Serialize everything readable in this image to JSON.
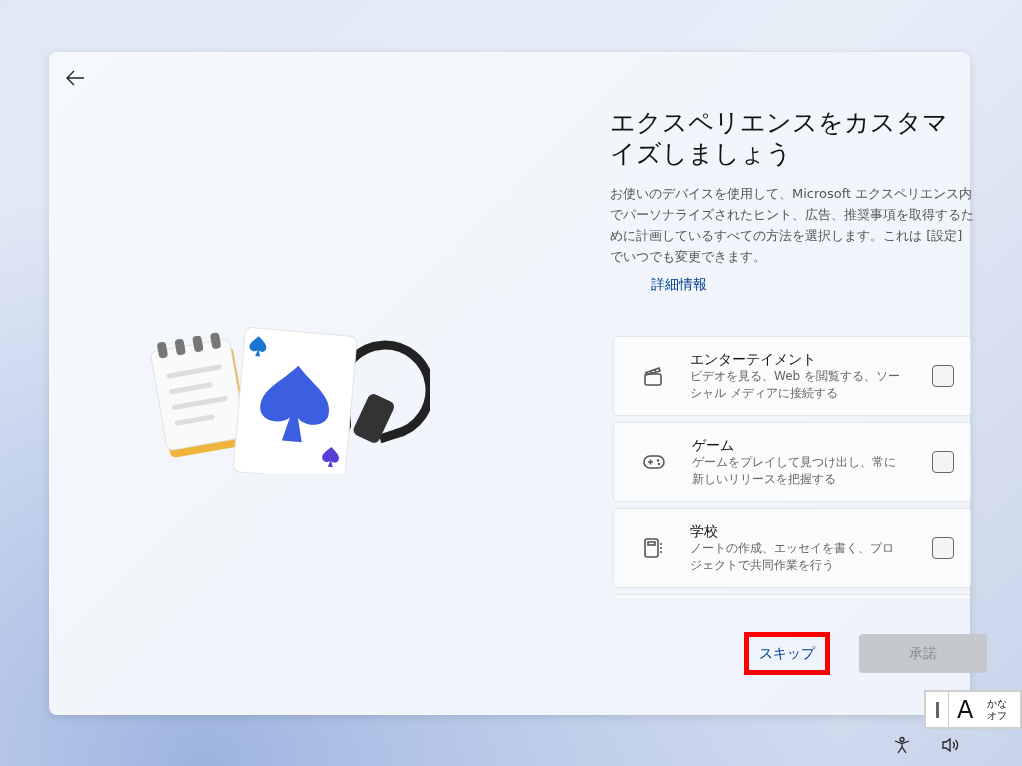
{
  "title": "エクスペリエンスをカスタマイズしましょう",
  "description": "お使いのデバイスを使用して、Microsoft エクスペリエンス内でパーソナライズされたヒント、広告、推奨事項を取得するために計画しているすべての方法を選択します。これは [設定] でいつでも変更できます。",
  "link": "詳細情報",
  "options": [
    {
      "kind": "entertainment",
      "title": "エンターテイメント",
      "description": "ビデオを見る、Web を閲覧する、ソーシャル メディアに接続する",
      "checked": false
    },
    {
      "kind": "gaming",
      "title": "ゲーム",
      "description": "ゲームをプレイして見つけ出し、常に新しいリリースを把握する",
      "checked": false
    },
    {
      "kind": "school",
      "title": "学校",
      "description": "ノートの作成、エッセイを書く、プロジェクトで共同作業を行う",
      "checked": false
    }
  ],
  "buttons": [
    {
      "label": "スキップ",
      "disabled": false,
      "highlighted": true
    },
    {
      "label": "承諾",
      "disabled": true,
      "highlighted": false
    }
  ],
  "ime": {
    "mode": "A",
    "kana_line_1": "かな",
    "kana_line_2": "オフ"
  }
}
